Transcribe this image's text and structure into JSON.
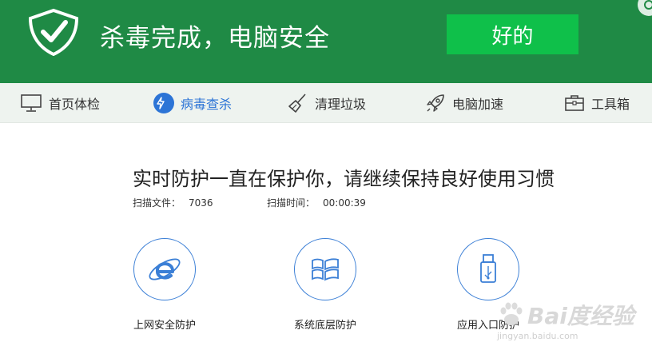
{
  "header": {
    "title": "杀毒完成，电脑安全",
    "ok_button": "好的",
    "logo_icon": "shield-check-icon",
    "colors": {
      "header_bg": "#1f8a45",
      "button_bg": "#0fc04a",
      "accent_blue": "#2c74d6"
    }
  },
  "nav": {
    "items": [
      {
        "label": "首页体检",
        "icon": "monitor-icon"
      },
      {
        "label": "病毒查杀",
        "icon": "lightning-icon",
        "active": true
      },
      {
        "label": "清理垃圾",
        "icon": "broom-icon"
      },
      {
        "label": "电脑加速",
        "icon": "rocket-icon"
      },
      {
        "label": "工具箱",
        "icon": "toolbox-icon"
      }
    ]
  },
  "main": {
    "headline": "实时防护一直在保护你，请继续保持良好使用习惯",
    "stats": [
      {
        "label": "扫描文件：",
        "value": "7036"
      },
      {
        "label": "扫描时间：",
        "value": "00:00:39"
      }
    ],
    "features": [
      {
        "label": "上网安全防护",
        "icon": "ie-browser-icon"
      },
      {
        "label": "系统底层防护",
        "icon": "windows-icon"
      },
      {
        "label": "应用入口防护",
        "icon": "usb-icon"
      }
    ]
  },
  "watermark": {
    "brand": "Bai度经验",
    "url": "jingyan.baidu.com"
  }
}
